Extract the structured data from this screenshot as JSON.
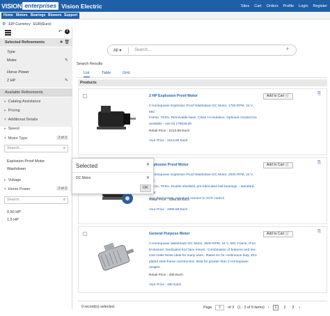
{
  "header": {
    "logo_left": "VISION",
    "logo_mid": "enterprises",
    "logo_brand": "Vision Electric",
    "nav": [
      "Sites",
      "Cart",
      "Orders",
      "Profile",
      "Login",
      "Register"
    ],
    "bg_color": "#1f5fa8"
  },
  "secnav": {
    "items": [
      "Home",
      "Motors",
      "Bearings",
      "Blowers",
      "Support"
    ]
  },
  "currency": {
    "icon": "gear-icon",
    "label": "EIP Currency",
    "value": "EUR(Euro)"
  },
  "sidebar": {
    "selected_refinements": "Selected Refinements",
    "refinements": [
      {
        "label": "Type",
        "value": "Motor"
      },
      {
        "label": "Horse Power",
        "value": "2 HP"
      }
    ],
    "available_refinements": "Available Refinements",
    "groups": [
      "Catalog Assistance",
      "Pricing",
      "Additional Details"
    ],
    "speed": "Speed",
    "motor_type": "Motor Type",
    "motor_type_count": "2 of 3",
    "search_placeholder": "Search...",
    "motor_type_options": [
      "Explosion Proof Motor",
      "Washdown"
    ],
    "voltage": "Voltage",
    "horse_power": "Horse Power",
    "horse_power_count": "2 of 2",
    "hp_options": [
      "0.50 HP",
      "1.5 HP"
    ]
  },
  "search": {
    "category": "All",
    "placeholder": "Search..."
  },
  "results": {
    "title": "Search Results",
    "tabs": [
      "List",
      "Table",
      "Grid"
    ],
    "products_label": "Products",
    "add_to_cart": "Add to Cart",
    "items": [
      {
        "name": "2 HP Explosion Proof Motor",
        "desc": [
          "2 Horsepower Explosion Proof Washdown DC Motor, 1750 RPM, 24 V, 56C",
          "Frame, TENV. Removable base, Class H insulation; Optional conduit box",
          "available - use kit 175028.00"
        ],
        "retail": "Retail Price : 2213.88 Each",
        "price": "Your Price : 2213.88 Each"
      },
      {
        "name": "Explosion Proof Motor",
        "desc": [
          "2 Horsepower Explosion Proof Washdown DC Motor, 2000 RPM, 24 V, 56C",
          "Frame, TENV. Double shielded, pre-lubricated ball bearings – standard, Pilot",
          "duty thermostats -standard connect to SCR control"
        ],
        "retail": "Retail Price : 4385.58 Each",
        "price": "Your Price : 4385.58 Each"
      },
      {
        "name": "General Purpose Motor",
        "desc": [
          "2 Horsepower Washdown DC Motor, 3000 RPM, 24 V, 56C Frame, IP44",
          "Enclosure, Dedicated 814 face mount.. Combination of features and low",
          "cost make these ideal for many uses.. Rated S1 for continuous duty, Zinc",
          "plated steel frame construction. Best for greater than 2 Horsepower usages."
        ],
        "retail": "Retail Price : 480 Each",
        "price": "Your Price : 480 Each"
      }
    ],
    "records": "0 record(s) selected.",
    "page_label": "Page",
    "page_value": "1",
    "page_of": "of 3",
    "page_range": "(1 - 3 of 9 items)",
    "pages": [
      "1",
      "2",
      "3"
    ]
  },
  "modal": {
    "title": "Selected",
    "item": "DC Motor",
    "ok": "OK"
  }
}
